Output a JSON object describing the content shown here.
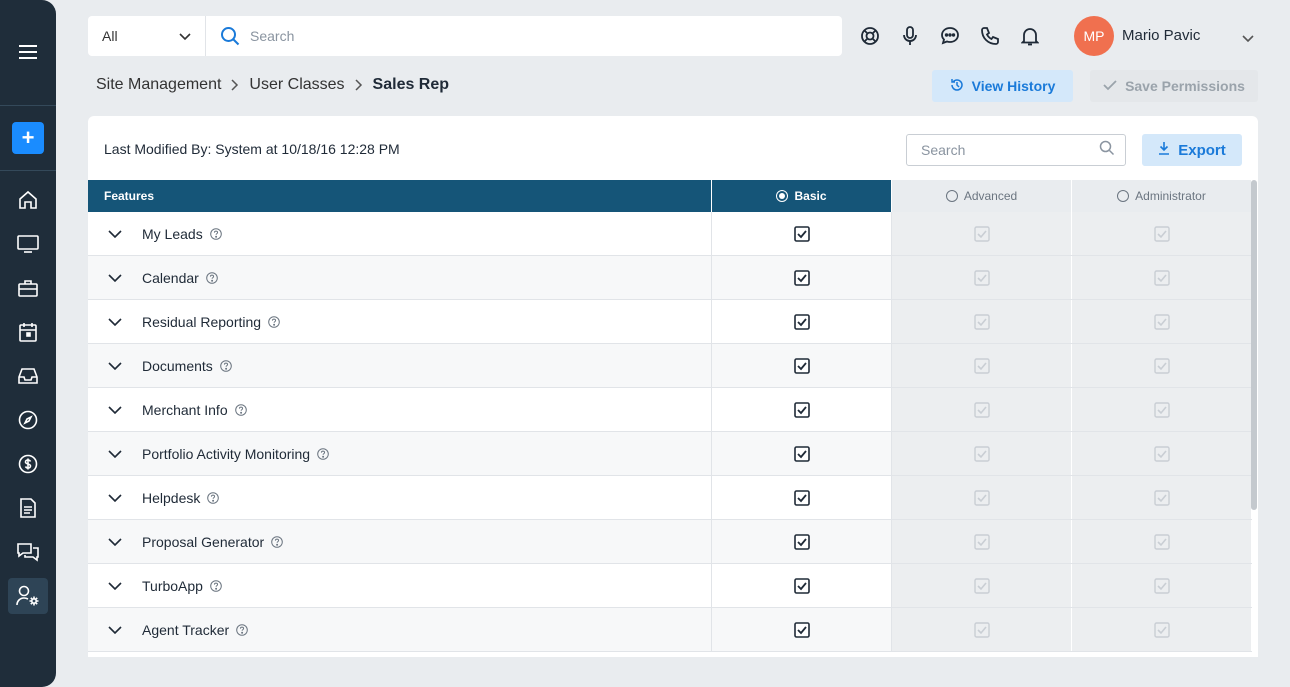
{
  "topbar": {
    "scope_value": "All",
    "search_placeholder": "Search",
    "user_initials": "MP",
    "user_name": "Mario Pavic"
  },
  "breadcrumb": {
    "items": [
      "Site Management",
      "User Classes"
    ],
    "current": "Sales Rep"
  },
  "actions": {
    "view_history": "View History",
    "save_permissions": "Save Permissions"
  },
  "card": {
    "last_modified": "Last Modified By: System at 10/18/16 12:28 PM",
    "search_placeholder": "Search",
    "export_label": "Export"
  },
  "table": {
    "headers": {
      "features": "Features",
      "basic": "Basic",
      "advanced": "Advanced",
      "administrator": "Administrator"
    },
    "selected_level": "Basic",
    "rows": [
      {
        "feature": "My Leads",
        "basic": true,
        "advanced": true,
        "administrator": true
      },
      {
        "feature": "Calendar",
        "basic": true,
        "advanced": true,
        "administrator": true
      },
      {
        "feature": "Residual Reporting",
        "basic": true,
        "advanced": true,
        "administrator": true
      },
      {
        "feature": "Documents",
        "basic": true,
        "advanced": true,
        "administrator": true
      },
      {
        "feature": "Merchant Info",
        "basic": true,
        "advanced": true,
        "administrator": true
      },
      {
        "feature": "Portfolio Activity Monitoring",
        "basic": true,
        "advanced": true,
        "administrator": true
      },
      {
        "feature": "Helpdesk",
        "basic": true,
        "advanced": true,
        "administrator": true
      },
      {
        "feature": "Proposal Generator",
        "basic": true,
        "advanced": true,
        "administrator": true
      },
      {
        "feature": "TurboApp",
        "basic": true,
        "advanced": true,
        "administrator": true
      },
      {
        "feature": "Agent Tracker",
        "basic": true,
        "advanced": true,
        "administrator": true
      }
    ]
  },
  "sidebar": {
    "icons": [
      "menu-icon",
      "add-icon",
      "home-icon",
      "monitor-icon",
      "briefcase-icon",
      "calendar-icon",
      "inbox-icon",
      "compass-icon",
      "dollar-icon",
      "document-icon",
      "chat-icon",
      "user-settings-icon"
    ],
    "active": "user-settings-icon"
  },
  "colors": {
    "sidebar_bg": "#1f2d3a",
    "accent": "#1a8cff",
    "table_header": "#155578",
    "avatar": "#f0704f"
  }
}
